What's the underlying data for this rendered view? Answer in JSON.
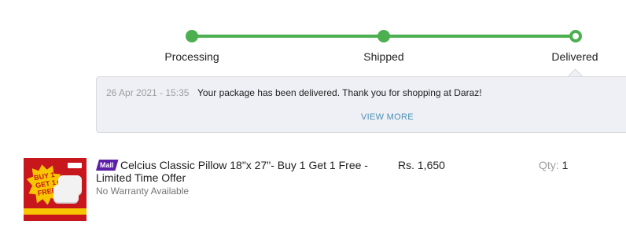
{
  "tracker": {
    "steps": [
      {
        "label": "Processing",
        "state": "complete"
      },
      {
        "label": "Shipped",
        "state": "complete"
      },
      {
        "label": "Delivered",
        "state": "current"
      }
    ],
    "color": "#4caf50"
  },
  "note": {
    "timestamp": "26 Apr 2021 - 15:35",
    "message": "Your package has been delivered. Thank you for shopping at Daraz!",
    "view_more_label": "VIEW MORE"
  },
  "item": {
    "badge": "Mall",
    "title": "Celcius Classic Pillow 18\"x 27\"- Buy 1 Get 1 Free - Limited Time Offer",
    "warranty": "No Warranty Available",
    "price": "Rs. 1,650",
    "qty_label": "Qty:",
    "qty_value": "1",
    "image": {
      "promo_text": "BUY 1 GET 1 FREE"
    }
  },
  "colors": {
    "accent_green": "#4caf50",
    "mall_purple": "#5d1fa7",
    "link_blue": "#4a8fb4"
  }
}
